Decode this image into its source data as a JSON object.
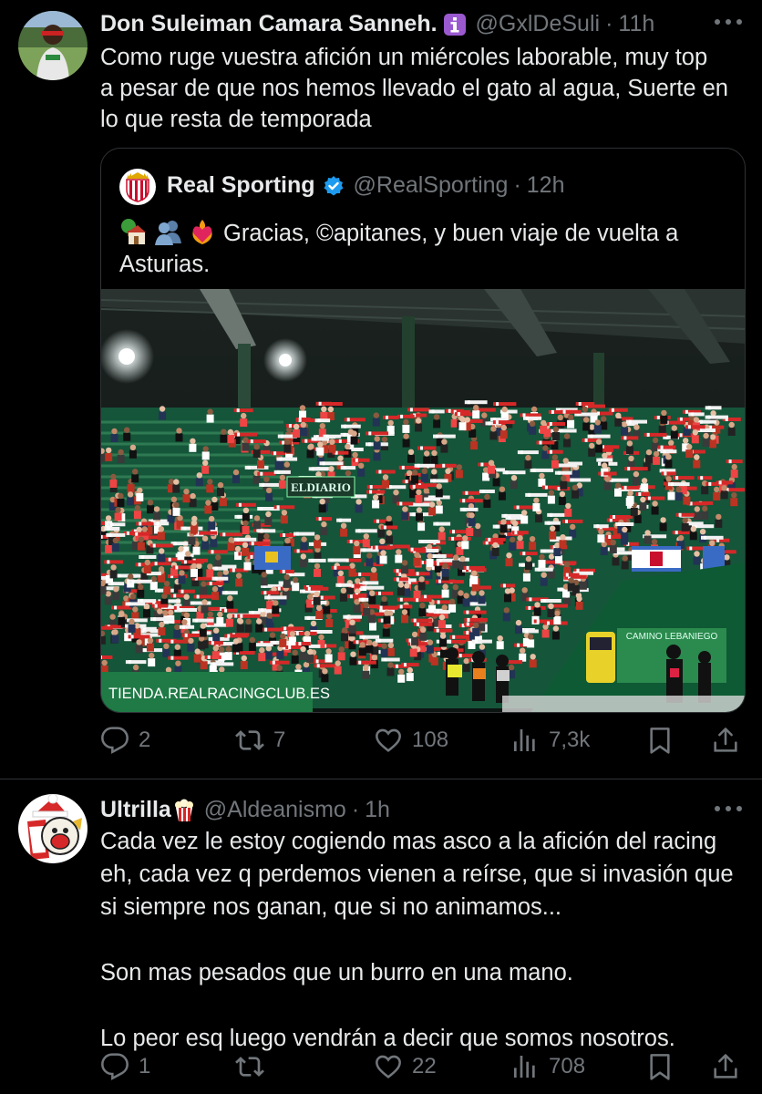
{
  "tweet1": {
    "name": "Don Suleiman Camara Sanneh.",
    "badge": "ℹ️",
    "handle": "@GxlDeSuli",
    "dot": "·",
    "time": "11h",
    "text": "Como ruge vuestra afición un miércoles laborable, muy top\na pesar de que nos hemos llevado el gato al agua, Suerte en\nlo que resta de temporada",
    "replies": "2",
    "retweets": "7",
    "likes": "108",
    "views": "7,3k"
  },
  "quote": {
    "name": "Real Sporting",
    "handle": "@RealSporting",
    "dot": "·",
    "time": "12h",
    "text": "Gracias, ©apitanes, y buen viaje de vuelta a Asturias.",
    "image": {
      "banner_text": "TIENDA.REALRACINGCLUB.ES",
      "sign_text": "ELDIARIO",
      "corner_sign": "CAMINO LEBANIEGO"
    }
  },
  "tweet2": {
    "name": "Ultrilla",
    "badge": "🍿",
    "handle": "@Aldeanismo",
    "dot": "·",
    "time": "1h",
    "text": "Cada vez le estoy cogiendo mas asco a la afición del racing\neh, cada vez q perdemos vienen a reírse, que si invasión que\nsi siempre nos ganan, que si no animamos...\n\nSon mas pesados que un burro en una mano.\n\nLo peor esq luego vendrán a decir que somos nosotros.",
    "replies": "1",
    "retweets": "",
    "likes": "22",
    "views": "708"
  },
  "colors": {
    "background": "#000000",
    "text": "#e7e9ea",
    "muted": "#71767b",
    "border": "#2f3336",
    "verified": "#1d9bf0"
  }
}
